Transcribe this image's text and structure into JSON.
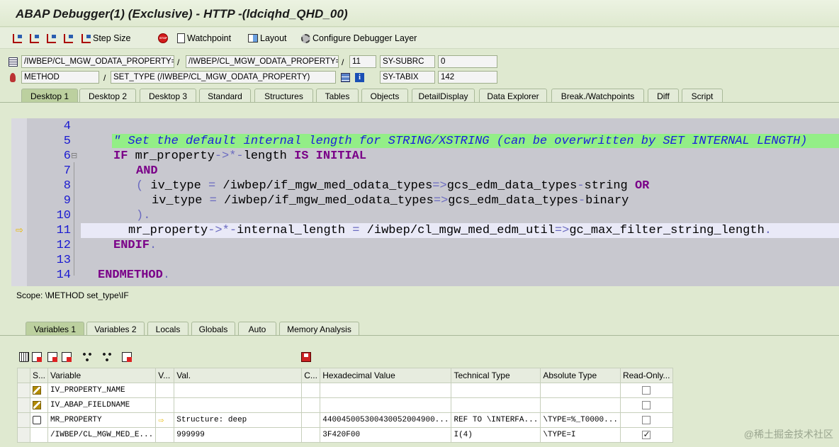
{
  "window": {
    "title": "ABAP Debugger(1)  (Exclusive) - HTTP -(ldciqhd_QHD_00)"
  },
  "toolbar": {
    "step_size": "Step Size",
    "watchpoint": "Watchpoint",
    "layout": "Layout",
    "configure": "Configure Debugger Layer"
  },
  "source": {
    "program": "/IWBEP/CL_MGW_ODATA_PROPERTY=...",
    "include": "/IWBEP/CL_MGW_ODATA_PROPERTY=...",
    "line": "11",
    "sy_subrc_label": "SY-SUBRC",
    "sy_subrc_value": "0",
    "event_type": "METHOD",
    "event": "SET_TYPE (/IWBEP/CL_MGW_ODATA_PROPERTY)",
    "sy_tabix_label": "SY-TABIX",
    "sy_tabix_value": "142",
    "slash1": "/",
    "slash2": "/",
    "slash3": "/"
  },
  "desktop_tabs": [
    "Desktop 1",
    "Desktop 2",
    "Desktop 3",
    "Standard",
    "Structures",
    "Tables",
    "Objects",
    "DetailDisplay",
    "Data Explorer",
    "Break./Watchpoints",
    "Diff",
    "Script"
  ],
  "code": {
    "line_numbers": [
      "4",
      "5",
      "6",
      "7",
      "8",
      "9",
      "10",
      "11",
      "12",
      "13",
      "14"
    ],
    "comment": "\" Set the default internal length for STRING/XSTRING (can be overwritten by SET INTERNAL LENGTH)"
  },
  "scope": "Scope: \\METHOD set_type\\IF",
  "variable_tabs": [
    "Variables 1",
    "Variables 2",
    "Locals",
    "Globals",
    "Auto",
    "Memory Analysis"
  ],
  "variables": {
    "headers": [
      "S...",
      "Variable",
      "V...",
      "Val.",
      "C...",
      "Hexadecimal Value",
      "Technical Type",
      "Absolute Type",
      "Read-Only..."
    ],
    "rows": [
      {
        "name": "IV_PROPERTY_NAME",
        "val": "",
        "hex": "",
        "tech": "",
        "abs": "",
        "ro": false
      },
      {
        "name": "IV_ABAP_FIELDNAME",
        "val": "",
        "hex": "",
        "tech": "",
        "abs": "",
        "ro": false
      },
      {
        "name": "MR_PROPERTY",
        "val": "Structure: deep",
        "hex": "440045005300430052004900...",
        "tech": "REF TO \\INTERFA...",
        "abs": "\\TYPE=%_T0000...",
        "ro": false
      },
      {
        "name": "/IWBEP/CL_MGW_MED_E...",
        "val": "999999",
        "hex": "3F420F00",
        "tech": "I(4)",
        "abs": "\\TYPE=I",
        "ro": true
      }
    ]
  },
  "watermark": "@稀土掘金技术社区"
}
